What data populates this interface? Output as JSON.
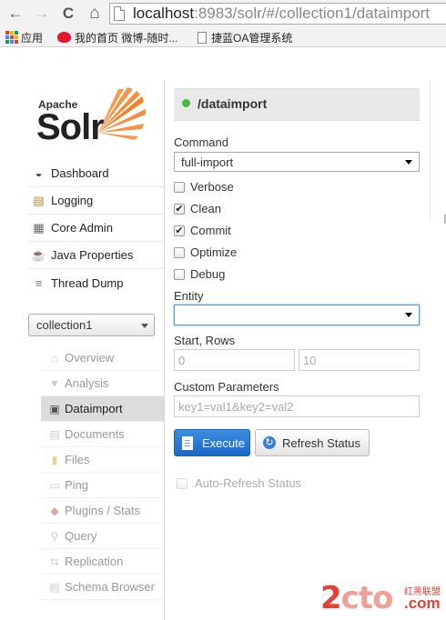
{
  "browser": {
    "back": "←",
    "forward": "→",
    "reload": "C",
    "home": "⌂",
    "url_host": "localhost",
    "url_rest": ":8983/solr/#/collection1/dataimport",
    "bookmarks": [
      {
        "label": "应用",
        "icon": "apps-icon"
      },
      {
        "label": "我的首页 微博-随时...",
        "icon": "weibo-icon"
      },
      {
        "label": "捷蓝OA管理系统",
        "icon": "page-icon"
      }
    ]
  },
  "logo": {
    "apache": "Apache",
    "solr": "Solr",
    "colors": {
      "sun": "#f48024",
      "text": "#222222"
    }
  },
  "nav": {
    "items": [
      {
        "label": "Dashboard",
        "icon": "dashboard-icon",
        "glyph": "◒"
      },
      {
        "label": "Logging",
        "icon": "logging-icon",
        "glyph": "▤"
      },
      {
        "label": "Core Admin",
        "icon": "core-admin-icon",
        "glyph": "▦"
      },
      {
        "label": "Java Properties",
        "icon": "java-icon",
        "glyph": "☕"
      },
      {
        "label": "Thread Dump",
        "icon": "thread-dump-icon",
        "glyph": "≡"
      }
    ]
  },
  "core_selector": {
    "value": "collection1"
  },
  "core_menu": {
    "items": [
      {
        "label": "Overview",
        "icon": "overview-icon",
        "glyph": "⌂",
        "active": false
      },
      {
        "label": "Analysis",
        "icon": "analysis-icon",
        "glyph": "▼",
        "active": false
      },
      {
        "label": "Dataimport",
        "icon": "dataimport-icon",
        "glyph": "▣",
        "active": true
      },
      {
        "label": "Documents",
        "icon": "documents-icon",
        "glyph": "▤",
        "active": false
      },
      {
        "label": "Files",
        "icon": "files-icon",
        "glyph": "▮",
        "active": false
      },
      {
        "label": "Ping",
        "icon": "ping-icon",
        "glyph": "▭",
        "active": false
      },
      {
        "label": "Plugins / Stats",
        "icon": "plugins-icon",
        "glyph": "◆",
        "active": false
      },
      {
        "label": "Query",
        "icon": "query-icon",
        "glyph": "⚲",
        "active": false
      },
      {
        "label": "Replication",
        "icon": "replication-icon",
        "glyph": "⇆",
        "active": false
      },
      {
        "label": "Schema Browser",
        "icon": "schema-browser-icon",
        "glyph": "▤",
        "active": false
      }
    ]
  },
  "dataimport": {
    "header": "/dataimport",
    "status_color": "#48b83f",
    "command_label": "Command",
    "command_value": "full-import",
    "options": [
      {
        "label": "Verbose",
        "checked": false
      },
      {
        "label": "Clean",
        "checked": true
      },
      {
        "label": "Commit",
        "checked": true
      },
      {
        "label": "Optimize",
        "checked": false
      },
      {
        "label": "Debug",
        "checked": false
      }
    ],
    "entity_label": "Entity",
    "entity_value": "",
    "start_rows_label": "Start, Rows",
    "start_placeholder": "0",
    "rows_placeholder": "10",
    "custom_params_label": "Custom Parameters",
    "custom_params_placeholder": "key1=val1&key2=val2",
    "execute_label": "Execute",
    "refresh_label": "Refresh Status",
    "auto_refresh_label": "Auto-Refresh Status"
  },
  "watermark": {
    "main_a": "2",
    "main_b": "cto",
    "cn": "红黑联盟",
    "com": ".com"
  }
}
